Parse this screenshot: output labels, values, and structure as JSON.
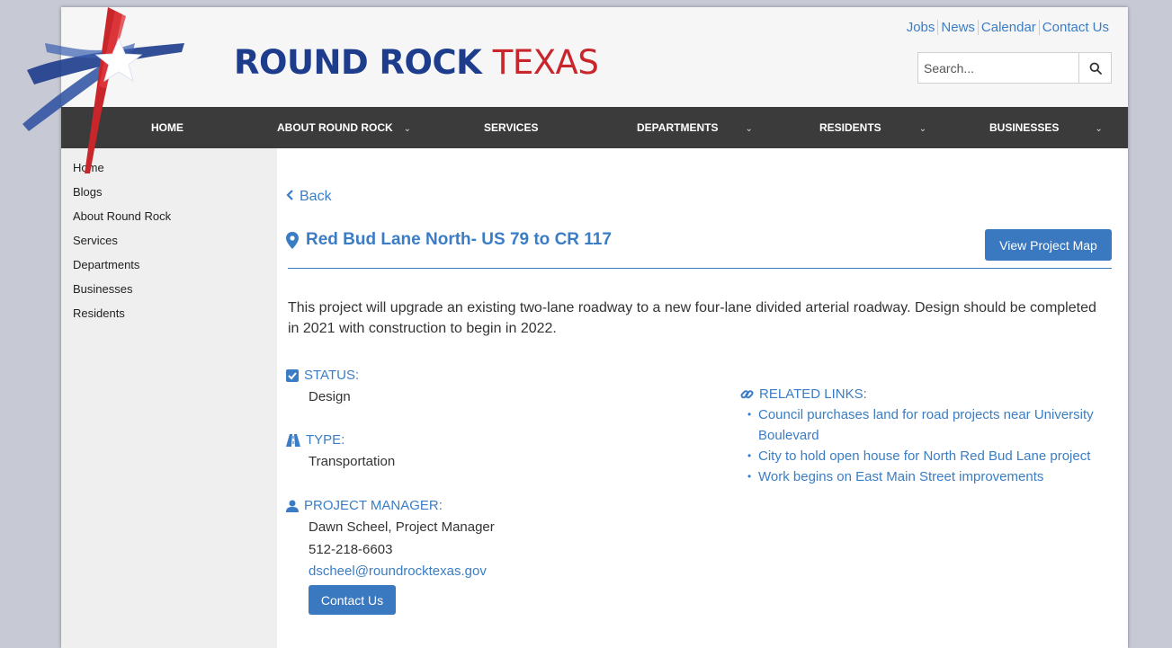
{
  "header": {
    "title_part1": "ROUND ROCK",
    "title_part2": "TEXAS",
    "utility_links": [
      "Jobs",
      "News",
      "Calendar",
      "Contact Us"
    ],
    "search_placeholder": "Search...",
    "search_icon": "search-icon"
  },
  "nav": {
    "items": [
      {
        "label": "HOME"
      },
      {
        "label": "ABOUT ROUND ROCK"
      },
      {
        "label": "SERVICES"
      },
      {
        "label": "DEPARTMENTS"
      },
      {
        "label": "RESIDENTS"
      },
      {
        "label": "BUSINESSES"
      }
    ]
  },
  "sidebar": {
    "items": [
      "Home",
      "Blogs",
      "About Round Rock",
      "Services",
      "Departments",
      "Businesses",
      "Residents"
    ]
  },
  "main": {
    "back_label": "Back",
    "project_title": "Red Bud Lane North- US 79 to CR 117",
    "view_map_label": "View Project Map",
    "description": "This project will upgrade an existing two-lane roadway to a new four-lane divided arterial roadway. Design should be completed in 2021 with construction to begin in 2022.",
    "status": {
      "label": "STATUS:",
      "value": "Design"
    },
    "type": {
      "label": "TYPE:",
      "value": "Transportation"
    },
    "manager": {
      "label": "PROJECT MANAGER:",
      "name": "Dawn Scheel, Project Manager",
      "phone": "512-218-6603",
      "email": "dscheel@roundrocktexas.gov"
    },
    "contact_button": "Contact Us",
    "related": {
      "label": "RELATED LINKS:",
      "links": [
        "Council purchases land for road projects near University Boulevard",
        "City to hold open house for North Red Bud Lane project",
        "Work begins on East Main Street improvements"
      ]
    }
  },
  "colors": {
    "brand_blue": "#1d3c8c",
    "brand_red": "#c8262b",
    "link_blue": "#3b7dc4",
    "nav_bg": "#3b3b3b",
    "button_blue": "#3a79c0"
  }
}
